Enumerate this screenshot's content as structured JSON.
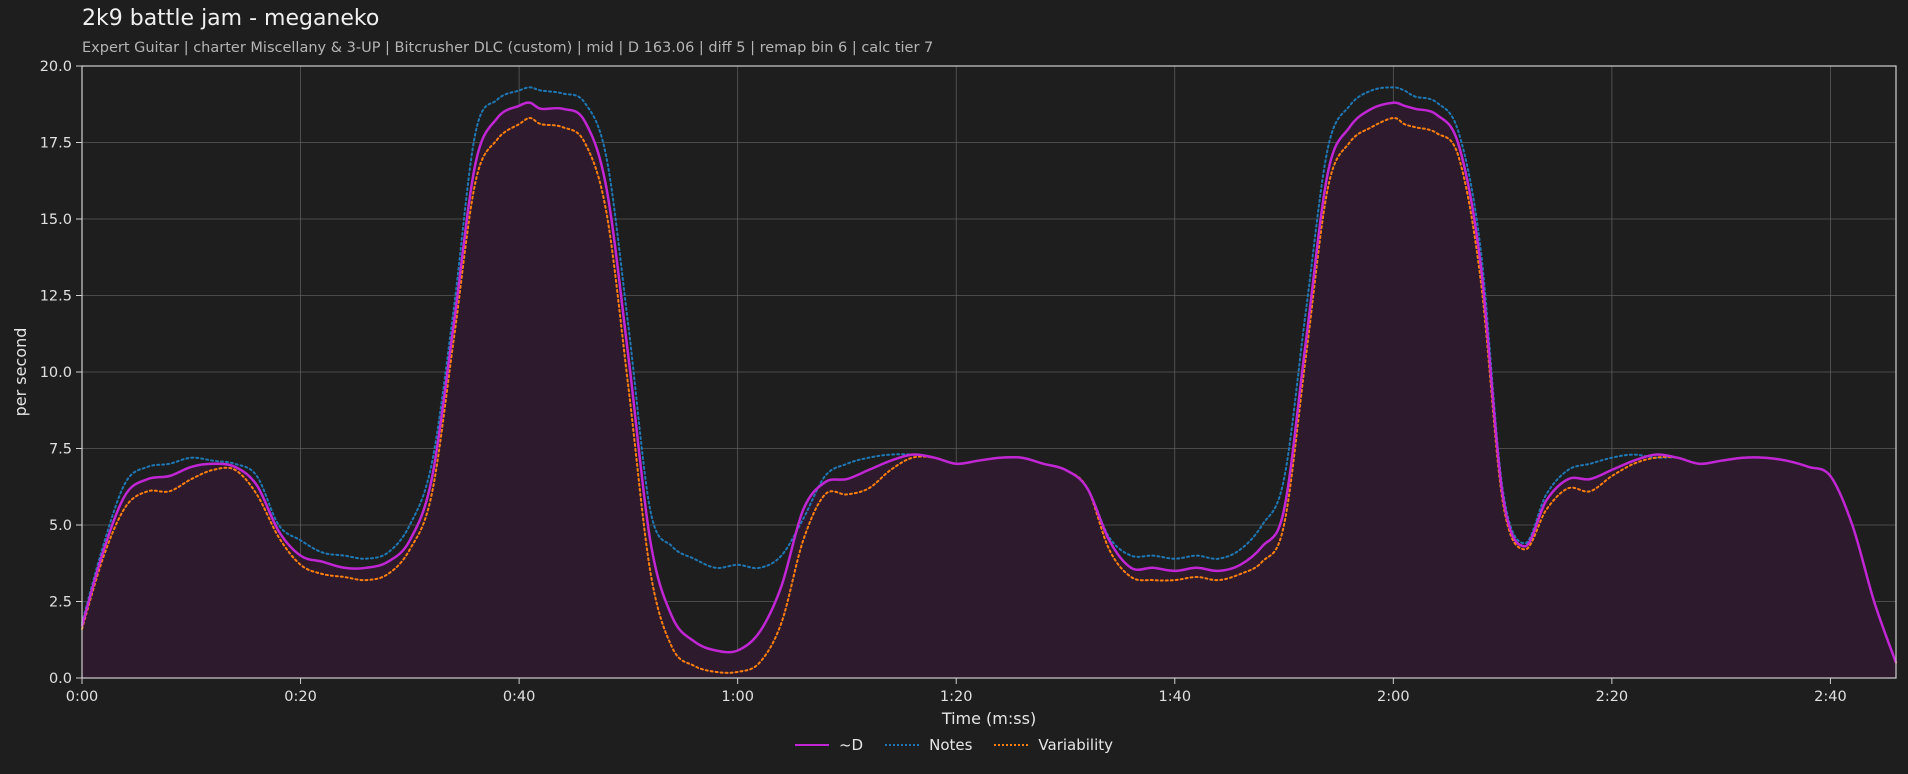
{
  "header": {
    "title": "2k9 battle jam - meganeko",
    "subtitle": "Expert Guitar  |  charter Miscellany & 3-UP  |  Bitcrusher DLC (custom)  |  mid  |  D 163.06  |  diff 5  |  remap bin 6  |  calc tier 7"
  },
  "colors": {
    "background": "#1e1e1e",
    "grid": "#5a5a5a",
    "d": "#c026d3",
    "d_fill": "#2d1a2d",
    "notes": "#1f77b4",
    "variability": "#ff7f0e"
  },
  "chart_data": {
    "type": "line",
    "title": "2k9 battle jam - meganeko",
    "xlabel": "Time (m:ss)",
    "ylabel": "per second",
    "xlim": [
      0,
      166
    ],
    "ylim": [
      0,
      20
    ],
    "grid": true,
    "legend_placement": "bottom-center",
    "x_ticks": [
      {
        "v": 0,
        "label": "0:00"
      },
      {
        "v": 20,
        "label": "0:20"
      },
      {
        "v": 40,
        "label": "0:40"
      },
      {
        "v": 60,
        "label": "1:00"
      },
      {
        "v": 80,
        "label": "1:20"
      },
      {
        "v": 100,
        "label": "1:40"
      },
      {
        "v": 120,
        "label": "2:00"
      },
      {
        "v": 140,
        "label": "2:20"
      },
      {
        "v": 160,
        "label": "2:40"
      }
    ],
    "y_ticks": [
      {
        "v": 0,
        "label": "0.0"
      },
      {
        "v": 2.5,
        "label": "2.5"
      },
      {
        "v": 5,
        "label": "5.0"
      },
      {
        "v": 7.5,
        "label": "7.5"
      },
      {
        "v": 10,
        "label": "10.0"
      },
      {
        "v": 12.5,
        "label": "12.5"
      },
      {
        "v": 15,
        "label": "15.0"
      },
      {
        "v": 17.5,
        "label": "17.5"
      },
      {
        "v": 20,
        "label": "20.0"
      }
    ],
    "x": [
      0,
      2,
      4,
      6,
      8,
      10,
      12,
      14,
      16,
      18,
      20,
      22,
      24,
      26,
      28,
      30,
      32,
      34,
      36,
      38,
      40,
      41,
      42,
      44,
      46,
      48,
      50,
      52,
      54,
      56,
      58,
      60,
      62,
      64,
      66,
      68,
      70,
      72,
      74,
      76,
      78,
      80,
      82,
      84,
      86,
      88,
      90,
      92,
      94,
      96,
      98,
      100,
      102,
      104,
      106,
      108,
      110,
      112,
      114,
      116,
      118,
      120,
      121,
      122,
      124,
      126,
      128,
      130,
      132,
      134,
      136,
      138,
      140,
      142,
      144,
      146,
      148,
      150,
      152,
      154,
      156,
      158,
      160,
      162,
      164,
      166
    ],
    "series": [
      {
        "name": "~D",
        "style": "solid",
        "values": [
          1.7,
          4.2,
          6.0,
          6.5,
          6.6,
          6.9,
          7.0,
          6.9,
          6.3,
          4.8,
          4.0,
          3.8,
          3.6,
          3.6,
          3.8,
          4.5,
          6.5,
          11.5,
          16.8,
          18.3,
          18.7,
          18.8,
          18.6,
          18.6,
          18.2,
          16.0,
          10.5,
          4.5,
          2.0,
          1.2,
          0.9,
          0.9,
          1.5,
          3.0,
          5.5,
          6.4,
          6.5,
          6.8,
          7.1,
          7.3,
          7.2,
          7.0,
          7.1,
          7.2,
          7.2,
          7.0,
          6.8,
          6.2,
          4.5,
          3.6,
          3.6,
          3.5,
          3.6,
          3.5,
          3.7,
          4.3,
          5.5,
          11.0,
          16.5,
          18.0,
          18.6,
          18.8,
          18.7,
          18.6,
          18.4,
          17.4,
          13.5,
          6.0,
          4.3,
          5.8,
          6.5,
          6.5,
          6.8,
          7.1,
          7.3,
          7.2,
          7.0,
          7.1,
          7.2,
          7.2,
          7.1,
          6.9,
          6.6,
          5.0,
          2.5,
          0.5
        ]
      },
      {
        "name": "Notes",
        "style": "dotted",
        "values": [
          1.8,
          4.4,
          6.4,
          6.9,
          7.0,
          7.2,
          7.1,
          7.0,
          6.6,
          5.0,
          4.5,
          4.1,
          4.0,
          3.9,
          4.1,
          5.0,
          7.0,
          12.0,
          17.8,
          18.9,
          19.2,
          19.3,
          19.2,
          19.1,
          18.8,
          17.0,
          11.5,
          5.5,
          4.3,
          3.9,
          3.6,
          3.7,
          3.6,
          4.0,
          5.2,
          6.6,
          7.0,
          7.2,
          7.3,
          7.3,
          7.2,
          7.0,
          7.1,
          7.2,
          7.2,
          7.0,
          6.8,
          6.2,
          4.6,
          4.0,
          4.0,
          3.9,
          4.0,
          3.9,
          4.2,
          5.0,
          6.5,
          12.0,
          17.3,
          18.7,
          19.2,
          19.3,
          19.2,
          19.0,
          18.8,
          17.8,
          14.0,
          6.2,
          4.4,
          6.0,
          6.8,
          7.0,
          7.2,
          7.3,
          7.2,
          7.2,
          7.0,
          7.1,
          7.2,
          7.2,
          7.1,
          6.9,
          6.6,
          5.0,
          2.5,
          0.5
        ]
      },
      {
        "name": "Variability",
        "style": "dotted",
        "values": [
          1.6,
          4.0,
          5.6,
          6.1,
          6.1,
          6.5,
          6.8,
          6.8,
          6.0,
          4.6,
          3.7,
          3.4,
          3.3,
          3.2,
          3.4,
          4.2,
          6.0,
          11.0,
          16.2,
          17.6,
          18.1,
          18.3,
          18.1,
          18.0,
          17.5,
          15.2,
          9.5,
          3.5,
          1.0,
          0.4,
          0.2,
          0.2,
          0.5,
          1.8,
          4.5,
          6.0,
          6.0,
          6.2,
          6.8,
          7.2,
          7.2,
          7.0,
          7.1,
          7.2,
          7.2,
          7.0,
          6.8,
          6.2,
          4.2,
          3.3,
          3.2,
          3.2,
          3.3,
          3.2,
          3.4,
          3.8,
          5.0,
          10.5,
          16.0,
          17.5,
          18.0,
          18.3,
          18.1,
          18.0,
          17.8,
          17.0,
          13.0,
          5.8,
          4.2,
          5.5,
          6.2,
          6.1,
          6.6,
          7.0,
          7.2,
          7.2,
          7.0,
          7.1,
          7.2,
          7.2,
          7.1,
          6.9,
          6.6,
          5.0,
          2.5,
          0.5
        ]
      }
    ]
  },
  "legend": [
    {
      "label": "~D",
      "style": "solid"
    },
    {
      "label": "Notes",
      "style": "dotted"
    },
    {
      "label": "Variability",
      "style": "dotted"
    }
  ]
}
